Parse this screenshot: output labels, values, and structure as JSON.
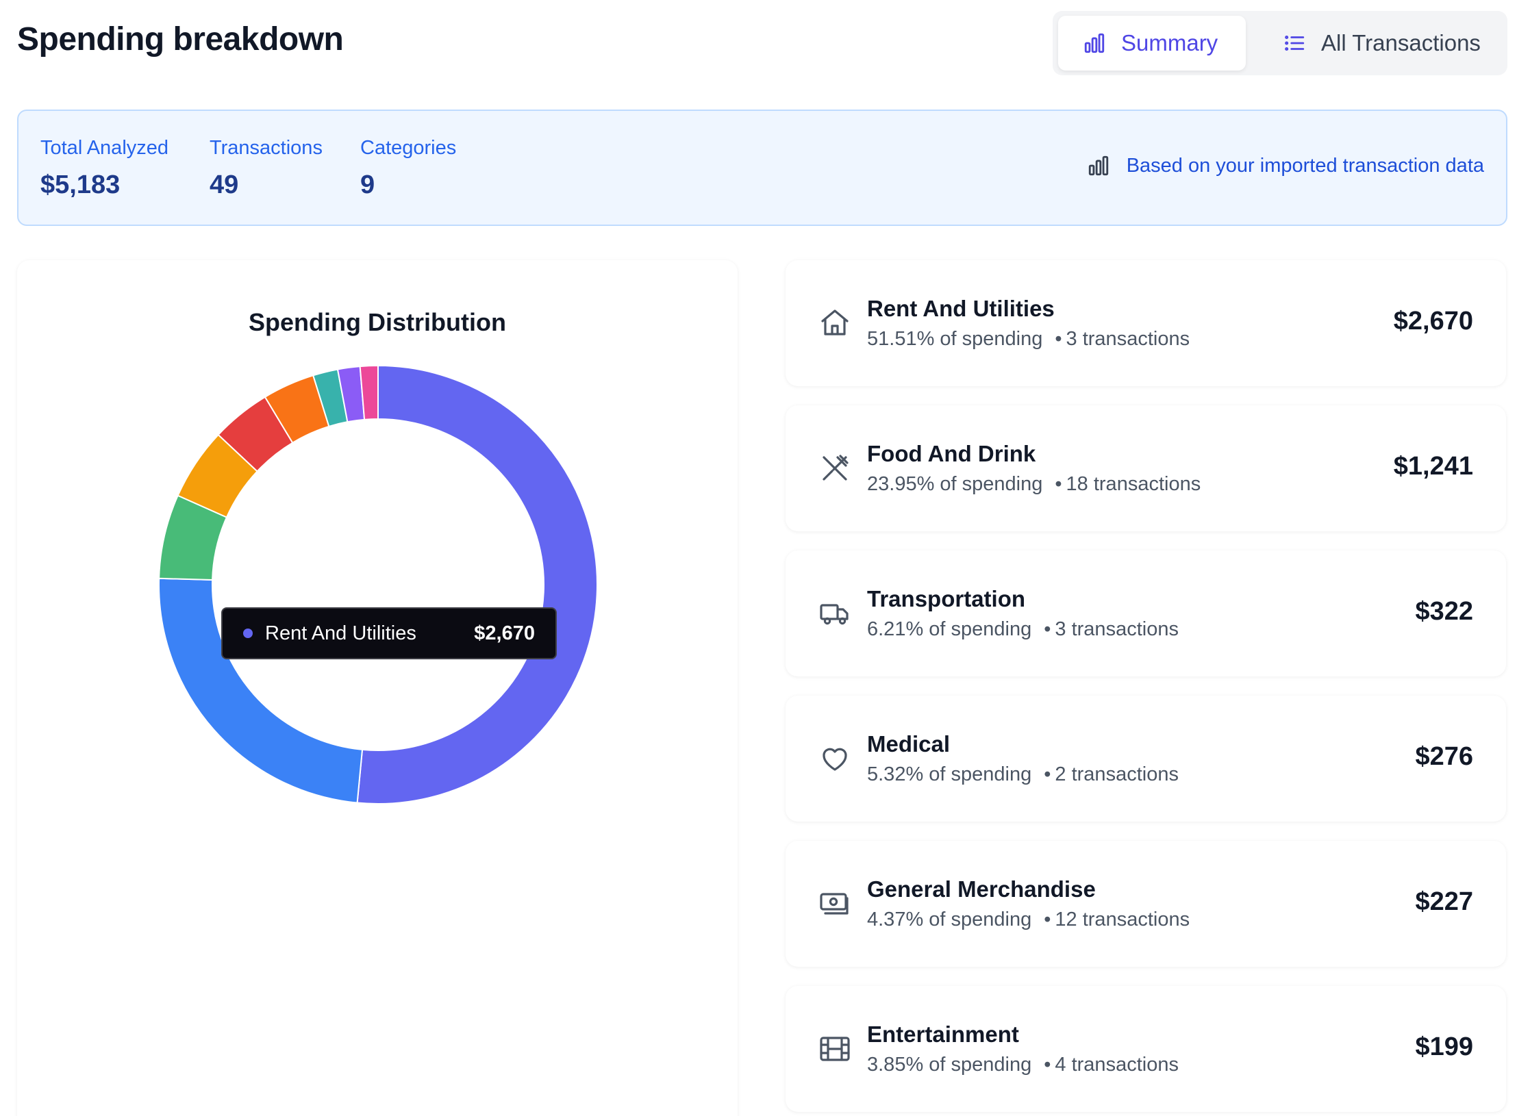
{
  "header": {
    "title": "Spending breakdown",
    "tabs": [
      {
        "label": "Summary",
        "icon": "bar-chart-icon",
        "active": true
      },
      {
        "label": "All Transactions",
        "icon": "list-icon",
        "active": false
      }
    ]
  },
  "stats": {
    "total_label": "Total Analyzed",
    "total_value": "$5,183",
    "transactions_label": "Transactions",
    "transactions_value": "49",
    "categories_label": "Categories",
    "categories_value": "9",
    "note": "Based on your imported transaction data"
  },
  "chart_panel": {
    "title": "Spending Distribution",
    "tooltip": {
      "label": "Rent And Utilities",
      "value": "$2,670",
      "color": "#6366f1"
    }
  },
  "chart_data": {
    "type": "pie",
    "title": "Spending Distribution",
    "donut": true,
    "slices": [
      {
        "label": "Rent And Utilities",
        "value": 2670,
        "color": "#6366f1"
      },
      {
        "label": "Food And Drink",
        "value": 1241,
        "color": "#3b82f6"
      },
      {
        "label": "Transportation",
        "value": 322,
        "color": "#48bb78"
      },
      {
        "label": "Medical",
        "value": 276,
        "color": "#f59e0b"
      },
      {
        "label": "General Merchandise",
        "value": 227,
        "color": "#e53e3e"
      },
      {
        "label": "Entertainment",
        "value": 199,
        "color": "#f97316"
      },
      {
        "label": "",
        "value": 95,
        "color": "#38b2ac"
      },
      {
        "label": "",
        "value": 85,
        "color": "#8b5cf6"
      },
      {
        "label": "",
        "value": 68,
        "color": "#ec4899"
      }
    ]
  },
  "categories": [
    {
      "name": "Rent And Utilities",
      "percent": "51.51% of spending",
      "transactions": "3 transactions",
      "amount": "$2,670",
      "icon": "home-icon"
    },
    {
      "name": "Food And Drink",
      "percent": "23.95% of spending",
      "transactions": "18 transactions",
      "amount": "$1,241",
      "icon": "utensils-icon"
    },
    {
      "name": "Transportation",
      "percent": "6.21% of spending",
      "transactions": "3 transactions",
      "amount": "$322",
      "icon": "truck-icon"
    },
    {
      "name": "Medical",
      "percent": "5.32% of spending",
      "transactions": "2 transactions",
      "amount": "$276",
      "icon": "heart-icon"
    },
    {
      "name": "General Merchandise",
      "percent": "4.37% of spending",
      "transactions": "12 transactions",
      "amount": "$227",
      "icon": "banknote-icon"
    },
    {
      "name": "Entertainment",
      "percent": "3.85% of spending",
      "transactions": "4 transactions",
      "amount": "$199",
      "icon": "film-icon"
    }
  ]
}
